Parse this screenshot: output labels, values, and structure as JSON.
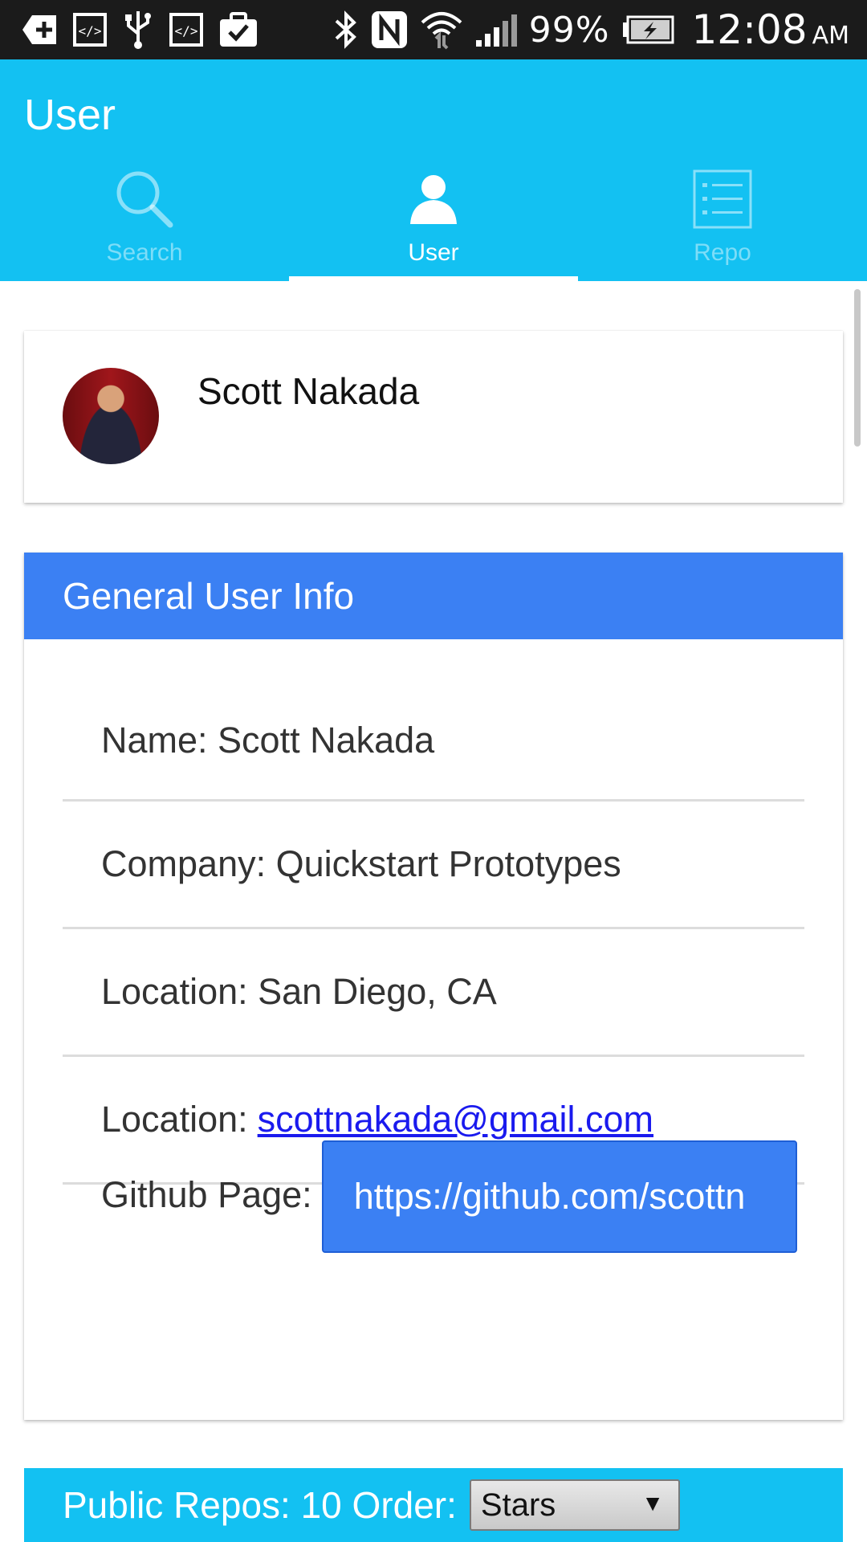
{
  "status_bar": {
    "battery_percent": "99%",
    "time": "12:08",
    "ampm": "AM",
    "icons": [
      "plus-arrow-icon",
      "code-icon",
      "usb-icon",
      "code-icon",
      "clipboard-check-icon",
      "bluetooth-icon",
      "nfc-icon",
      "wifi-icon",
      "signal-icon",
      "battery-charging-icon"
    ]
  },
  "app_bar": {
    "title": "User",
    "tabs": [
      {
        "label": "Search",
        "icon": "search-icon",
        "active": false
      },
      {
        "label": "User",
        "icon": "user-icon",
        "active": true
      },
      {
        "label": "Repo",
        "icon": "list-icon",
        "active": false
      }
    ]
  },
  "profile": {
    "name": "Scott Nakada"
  },
  "general_info": {
    "header": "General User Info",
    "name_row": "Name: Scott Nakada",
    "company_row": "Company: Quickstart Prototypes",
    "location_row": "Location: San Diego, CA",
    "email_label": "Location:",
    "email": "scottnakada@gmail.com",
    "github_label": "Github Page:",
    "github_url": "https://github.com/scottn"
  },
  "repos": {
    "label": "Public Repos: 10 Order:",
    "order_selected": "Stars",
    "dropdown_arrow": "▼"
  },
  "colors": {
    "app_bar": "#13c1f2",
    "card_header": "#3b80f3",
    "link": "#1a1aee"
  }
}
